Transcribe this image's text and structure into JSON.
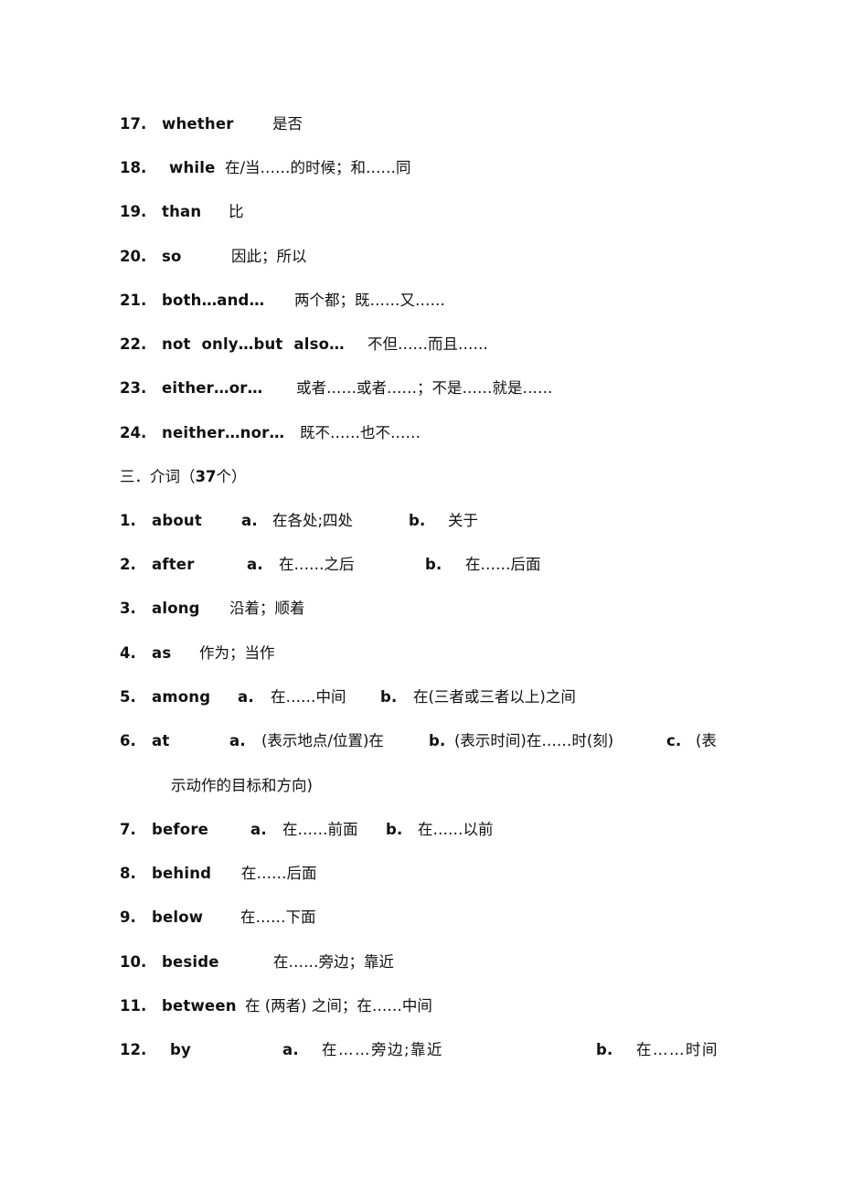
{
  "conjunctions_continued": [
    {
      "num": "17.",
      "word": "whether",
      "meaning": "是否"
    },
    {
      "num": "18.",
      "word": "while",
      "meaning": "在/当……的时候；和……同"
    },
    {
      "num": "19.",
      "word": "than",
      "meaning": "比"
    },
    {
      "num": "20.",
      "word": "so",
      "meaning": "因此；所以"
    },
    {
      "num": "21.",
      "word": "both…and…",
      "meaning": "两个都；既……又……"
    },
    {
      "num": "22.",
      "word": "not  only…but  also…",
      "meaning": "不但……而且……"
    },
    {
      "num": "23.",
      "word": "either…or…",
      "meaning": "或者……或者……；不是……就是……"
    },
    {
      "num": "24.",
      "word": "neither…nor…",
      "meaning": "既不……也不……"
    }
  ],
  "section_heading": {
    "prefix": "三．介词（",
    "count": "37",
    "suffix": "个）"
  },
  "prepositions": [
    {
      "num": "1.",
      "word": "about",
      "a_label": "a.",
      "a": "在各处;四处",
      "b_label": "b.",
      "b": "关于"
    },
    {
      "num": "2.",
      "word": "after",
      "a_label": "a.",
      "a": "在……之后",
      "b_label": "b.",
      "b": "在……后面"
    },
    {
      "num": "3.",
      "word": "along",
      "meaning": "沿着；顺着"
    },
    {
      "num": "4.",
      "word": "as",
      "meaning": "作为；当作"
    },
    {
      "num": "5.",
      "word": "among",
      "a_label": "a.",
      "a": "在……中间",
      "b_label": "b.",
      "b": "在(三者或三者以上)之间"
    },
    {
      "num": "6.",
      "word": "at",
      "a_label": "a.",
      "a": "(表示地点/位置)在",
      "b_label": "b.",
      "b": "(表示时间)在……时(刻)",
      "c_label": "c.",
      "c": "(表",
      "c_cont": "示动作的目标和方向)"
    },
    {
      "num": "7.",
      "word": "before",
      "a_label": "a.",
      "a": "在……前面",
      "b_label": "b.",
      "b": "在……以前"
    },
    {
      "num": "8.",
      "word": "behind",
      "meaning": "在……后面"
    },
    {
      "num": "9.",
      "word": "below",
      "meaning": "在……下面"
    },
    {
      "num": "10.",
      "word": "beside",
      "meaning": "在……旁边；靠近"
    },
    {
      "num": "11.",
      "word": "between",
      "meaning": "在 (两者) 之间；在……中间"
    },
    {
      "num": "12.",
      "word": "by",
      "a_label": "a.",
      "a": "在……旁边;靠近",
      "b_label": "b.",
      "b": "在……时间"
    }
  ]
}
